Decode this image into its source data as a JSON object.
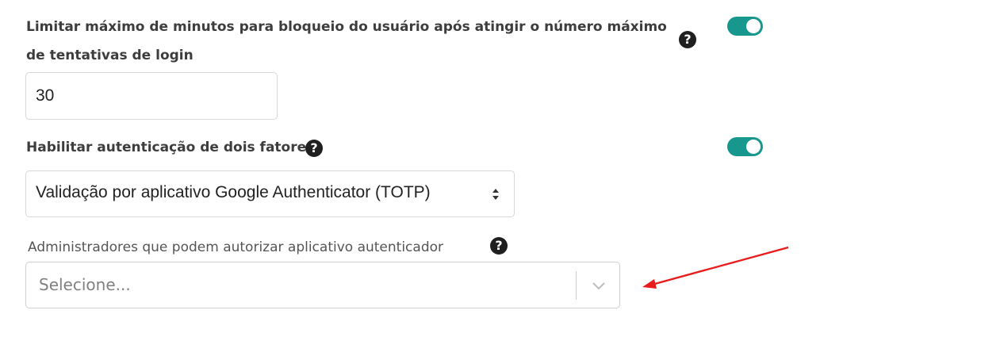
{
  "settings": {
    "max_block_minutes": {
      "label": "Limitar máximo de minutos para bloqueio do usuário após atingir o número máximo de tentativas de login",
      "value": "30",
      "enabled": true
    },
    "two_factor": {
      "label": "Habilitar autenticação de dois fatores",
      "selected_method": "Validação por aplicativo Google Authenticator (TOTP)",
      "enabled": true
    },
    "authorizing_admins": {
      "label": "Administradores que podem autorizar aplicativo autenticador",
      "placeholder": "Selecione..."
    }
  },
  "icons": {
    "help": "?",
    "toggle_color": "#17978d",
    "annotation_arrow_color": "#e81c1c"
  }
}
